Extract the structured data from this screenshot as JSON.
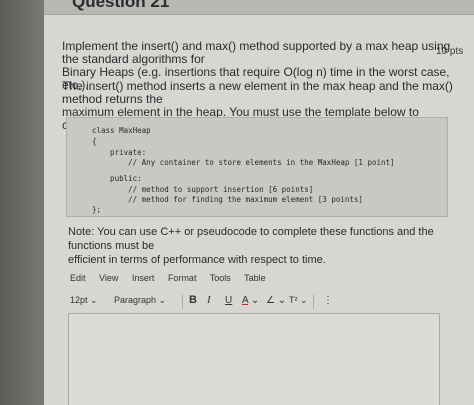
{
  "question": {
    "title": "Question 21",
    "points": "10 pts",
    "prompt_lines": [
      "Implement the insert() and max() method supported by a max heap using the standard algorithms for",
      "Binary Heaps (e.g. insertions that require O(log n) time in the worst case, etc.)."
    ],
    "description_lines": [
      "The insert() method inserts a new element in the max heap and the max() method returns the",
      "maximum element in the heap. You must use the template below to complete these functions."
    ],
    "code_lines": [
      "class MaxHeap",
      "{",
      "    private:",
      "        // Any container to store elements in the MaxHeap [1 point]",
      "    public:",
      "        // method to support insertion [6 points]",
      "        // method for finding the maximum element [3 points]",
      "};"
    ],
    "note_lines": [
      "Note: You can use C++ or pseudocode to complete these functions and the functions must be",
      "efficient in terms of performance with respect to time."
    ]
  },
  "editor": {
    "menu": [
      "Edit",
      "View",
      "Insert",
      "Format",
      "Tools",
      "Table"
    ],
    "toolbar": {
      "font_size": "12pt",
      "paragraph": "Paragraph",
      "bold": "B",
      "italic": "I",
      "underline": "U",
      "text_color": "A",
      "highlight": "∠",
      "superscript": "T²",
      "more": "⋮"
    },
    "content": ""
  }
}
